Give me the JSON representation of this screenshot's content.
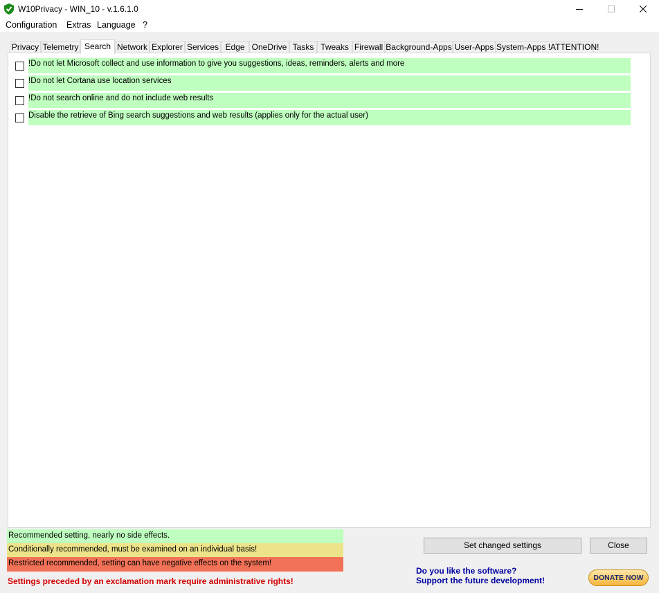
{
  "window": {
    "title": "W10Privacy - WIN_10 - v.1.6.1.0"
  },
  "menu": [
    "Configuration",
    "Extras",
    "Language",
    "?"
  ],
  "tabs": [
    "Privacy",
    "Telemetry",
    "Search",
    "Network",
    "Explorer",
    "Services",
    "Edge",
    "OneDrive",
    "Tasks",
    "Tweaks",
    "Firewall",
    "Background-Apps",
    "User-Apps",
    "System-Apps !ATTENTION!"
  ],
  "active_tab": "Search",
  "settings": [
    {
      "label": "!Do not let Microsoft collect and use information to give you suggestions, ideas, reminders, alerts and more",
      "checked": false
    },
    {
      "label": "!Do not let Cortana use location services",
      "checked": false
    },
    {
      "label": "!Do not search online and do not include web results",
      "checked": false
    },
    {
      "label": "Disable the retrieve of Bing search suggestions and web results (applies only for the actual user)",
      "checked": false
    }
  ],
  "legend": {
    "recommended": "Recommended setting, nearly no side effects.",
    "conditional": "Conditionally recommended, must be examined on an individual basis!",
    "restricted": "Restricted recommended, setting can have negative effects on the system!"
  },
  "admin_note": "Settings preceded by an exclamation mark require administrative rights!",
  "buttons": {
    "set_changed": "Set changed settings",
    "close": "Close"
  },
  "donate": {
    "line1": "Do you like the software?",
    "line2": "Support the future development!",
    "button": "DONATE NOW"
  },
  "colors": {
    "recommended": "#bfffbf",
    "conditional": "#ede48a",
    "restricted": "#f27257",
    "admin_note": "#d40000"
  },
  "icons": {
    "app": "shield-check-icon",
    "minimize": "minimize-icon",
    "maximize": "maximize-icon",
    "close": "close-icon"
  }
}
